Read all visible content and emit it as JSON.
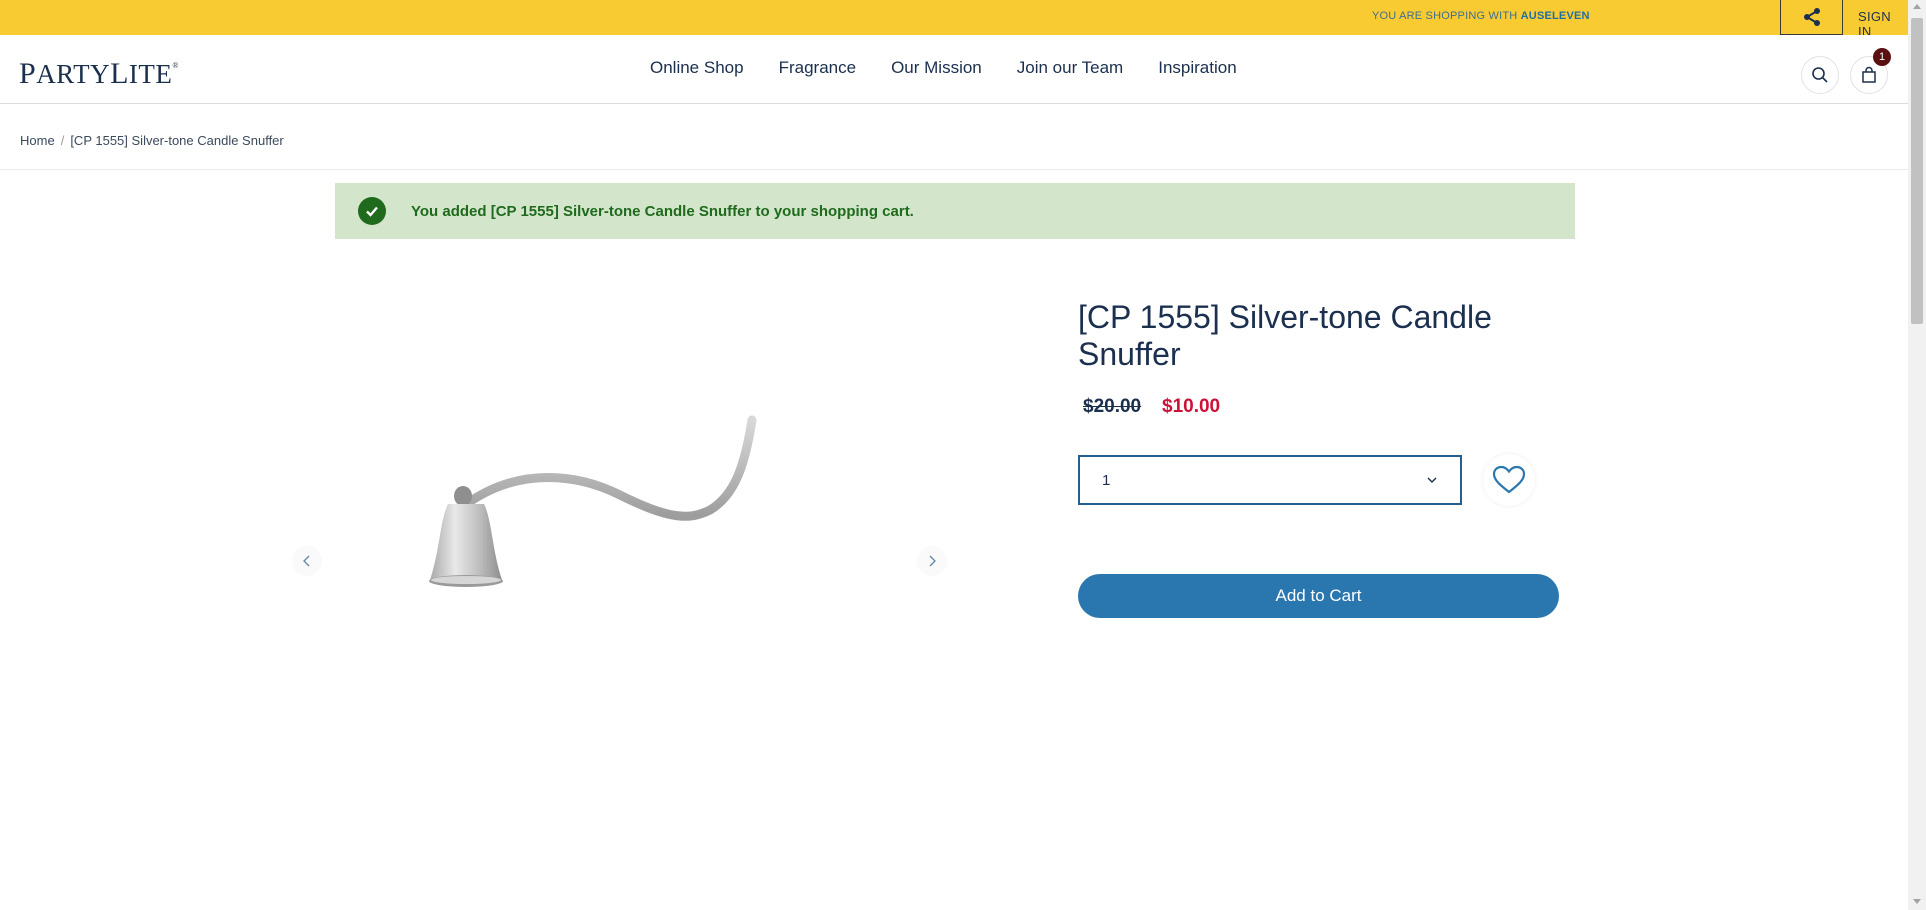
{
  "topbar": {
    "shopping_prefix": "YOU ARE SHOPPING WITH",
    "host": "AUSELEVEN",
    "sign_in": "SIGN IN"
  },
  "header": {
    "logo_first": "P",
    "logo_rest": "ARTY",
    "logo_first2": "L",
    "logo_rest2": "ITE",
    "logo_mark": "®",
    "nav": [
      "Online Shop",
      "Fragrance",
      "Our Mission",
      "Join our Team",
      "Inspiration"
    ],
    "cart_count": "1"
  },
  "breadcrumb": {
    "home": "Home",
    "separator": "/",
    "current": "[CP 1555] Silver-tone Candle Snuffer"
  },
  "message": {
    "text": "You added [CP 1555] Silver-tone Candle Snuffer to your shopping cart."
  },
  "product": {
    "title": "[CP 1555] Silver-tone Candle Snuffer",
    "price_old": "$20.00",
    "price_new": "$10.00",
    "quantity": "1",
    "add_to_cart": "Add to Cart"
  },
  "colors": {
    "topbar": "#f9cb33",
    "navy": "#1b2f4e",
    "sale_red": "#cc1236",
    "success_bg": "#d3e6cc",
    "success_text": "#1f6a1c",
    "button_blue": "#2a77b0"
  }
}
